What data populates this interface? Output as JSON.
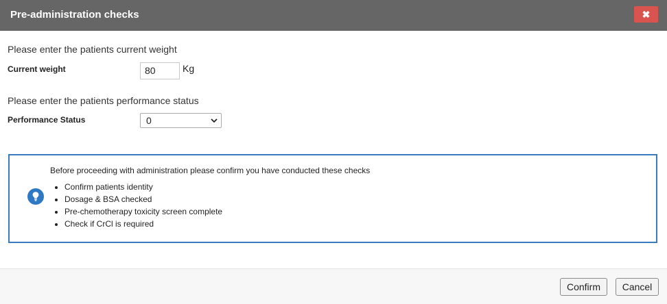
{
  "dialog": {
    "title": "Pre-administration checks",
    "close_icon": "close-icon",
    "close_glyph": "✖"
  },
  "weight": {
    "prompt": "Please enter the patients current weight",
    "label": "Current weight",
    "value": "80",
    "unit": "Kg"
  },
  "performance": {
    "prompt": "Please enter the patients performance status",
    "label": "Performance Status",
    "selected": "0"
  },
  "info": {
    "icon": "lightbulb-icon",
    "accent_color": "#2f78c4",
    "heading": "Before proceeding with administration please confirm you have conducted these checks",
    "checks": [
      "Confirm patients identity",
      "Dosage & BSA checked",
      "Pre-chemotherapy toxicity screen complete",
      "Check if CrCl is required"
    ]
  },
  "footer": {
    "confirm_label": "Confirm",
    "cancel_label": "Cancel"
  },
  "colors": {
    "title_bar": "#666666",
    "close_button": "#d9534f",
    "info_border": "#3a7bbf"
  }
}
